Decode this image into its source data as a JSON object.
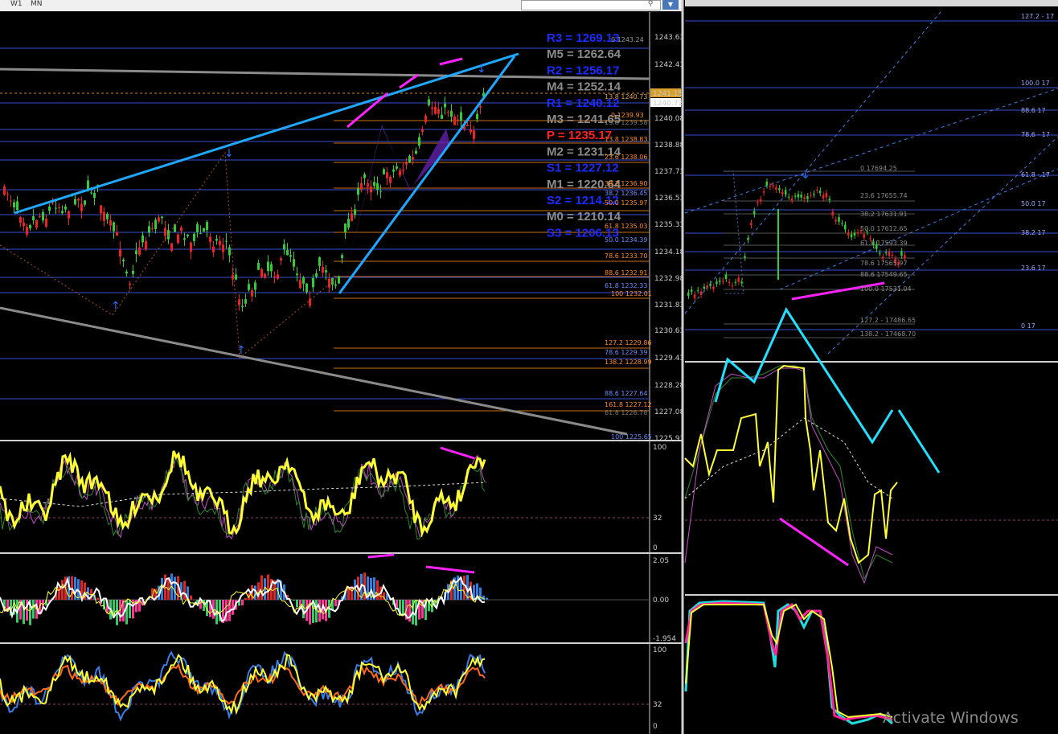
{
  "toolbar": {
    "timeframes": [
      "W1",
      "MN"
    ],
    "search_icon": "search-icon",
    "menu_icon": "dropdown-icon"
  },
  "watermark": "Activate Windows",
  "main_chart": {
    "price_axis": [
      "1243.63",
      "1242.43",
      "1240.08",
      "1238.88",
      "1237.73",
      "1236.53",
      "1235.33",
      "1234.18",
      "1232.98",
      "1231.83",
      "1230.63",
      "1229.43",
      "1228.28",
      "1227.08",
      "1225.93"
    ],
    "current_price": "1241.15",
    "bid_price": "1240.73",
    "pivots": [
      {
        "label": "R3 = 1269.13",
        "color": "#1a2cff"
      },
      {
        "label": "M5 = 1262.64",
        "color": "#8c8c8c"
      },
      {
        "label": "R2 = 1256.17",
        "color": "#1a2cff"
      },
      {
        "label": "M4 = 1252.14",
        "color": "#8c8c8c"
      },
      {
        "label": "R1 = 1240.12",
        "color": "#1a2cff"
      },
      {
        "label": "M3 = 1241.65",
        "color": "#8c8c8c"
      },
      {
        "label": "P  = 1235.17",
        "color": "#ff2020"
      },
      {
        "label": "M2 = 1231.14",
        "color": "#8c8c8c"
      },
      {
        "label": "S1 = 1227.12",
        "color": "#1a2cff"
      },
      {
        "label": "M1 = 1220.64",
        "color": "#8c8c8c"
      },
      {
        "label": "S2 = 1214.12",
        "color": "#1a2cff"
      },
      {
        "label": "M0 = 1210.14",
        "color": "#8c8c8c"
      },
      {
        "label": "S3 = 1206.13",
        "color": "#1a2cff"
      }
    ],
    "fib_labels": [
      {
        "text": "0 1243.24",
        "color": "#9a9a9a"
      },
      {
        "text": "13.8 1240.73",
        "color": "#e0a040"
      },
      {
        "text": "0 1239.93",
        "color": "#ff8c1a"
      },
      {
        "text": "13.8 1239.58",
        "color": "#7a7a7a"
      },
      {
        "text": "13.8 1238.83",
        "color": "#ff8c1a"
      },
      {
        "text": "23.6 1238.06",
        "color": "#ff8c1a"
      },
      {
        "text": "38.2 1236.90",
        "color": "#ff8c1a"
      },
      {
        "text": "38.2 1236.45",
        "color": "#6a8cff"
      },
      {
        "text": "50.0 1235.97",
        "color": "#ff8c1a"
      },
      {
        "text": "61.8 1235.03",
        "color": "#ff8c1a"
      },
      {
        "text": "50.0 1234.39",
        "color": "#6a8cff"
      },
      {
        "text": "78.6 1233.70",
        "color": "#ff8c1a"
      },
      {
        "text": "88.6 1232.91",
        "color": "#ff8c1a"
      },
      {
        "text": "61.8 1232.33",
        "color": "#6a8cff"
      },
      {
        "text": "100 1232.01",
        "color": "#ff8c1a"
      },
      {
        "text": "127.2 1229.86",
        "color": "#ff8c1a"
      },
      {
        "text": "78.6 1229.39",
        "color": "#6a8cff"
      },
      {
        "text": "138.2 1228.99",
        "color": "#ff8c1a"
      },
      {
        "text": "88.6 1227.64",
        "color": "#6a8cff"
      },
      {
        "text": "161.8 1227.12",
        "color": "#ff8c1a"
      },
      {
        "text": "61.8 1226.78",
        "color": "#7a7a7a"
      },
      {
        "text": "100 1225.65",
        "color": "#6a8cff"
      }
    ]
  },
  "osc1": {
    "axis": [
      "100",
      "32",
      "0"
    ]
  },
  "osc2": {
    "axis": [
      "2.05",
      "0.00",
      "-1.954"
    ]
  },
  "osc3": {
    "axis": [
      "100",
      "32",
      "0"
    ]
  },
  "right_chart": {
    "fib_right_edge": [
      "127.2 - 17",
      "100.0 17",
      "88.6 17",
      "78.6 - 17",
      "61.8 - 17",
      "50.0 17",
      "38.2 17",
      "23.6 17",
      "0 17"
    ],
    "fib_labels": [
      "0 17694.25",
      "23.6 17655.74",
      "38.2 17631.91",
      "50.0 17612.65",
      "61.8 17593.39",
      "78.6 17565.97",
      "88.6 17549.65",
      "100.0 17531.04",
      "127.2 - 17486.65",
      "138.2 - 17468.70"
    ]
  },
  "colors": {
    "trendline": "#1ea8ff",
    "harmonic": "#5a1ea0",
    "arrow_magenta": "#ff22ff",
    "arrow_cyan": "#22e0ff",
    "bull": "#33cc33",
    "bear": "#ee2222",
    "osc_yellow": "#ffff33"
  }
}
